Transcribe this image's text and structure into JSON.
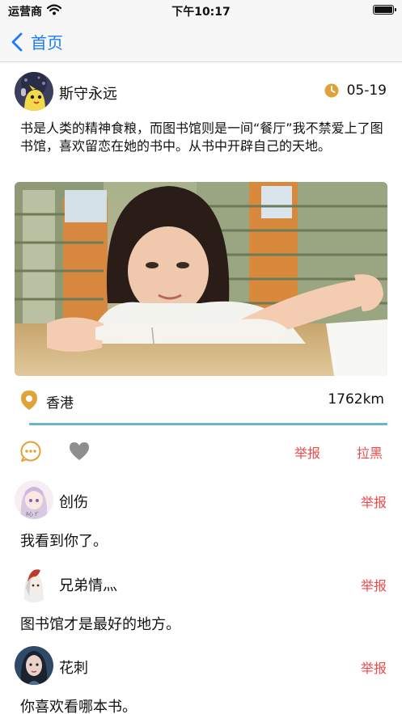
{
  "status_bar": {
    "carrier": "运营商",
    "time": "下午10:17"
  },
  "nav": {
    "back_label": "首页"
  },
  "post": {
    "username": "斯守永远",
    "date": "05-19",
    "text": "书是人类的精神食粮，而图书馆则是一间“餐厅”我不禁爱上了图书馆，喜欢留恋在她的书中。从书中开辟自己的天地。",
    "location": "香港",
    "distance": "1762km",
    "report_label": "举报",
    "block_label": "拉黑"
  },
  "comments": [
    {
      "name": "创伤",
      "text": "我看到你了。",
      "report_label": "举报"
    },
    {
      "name": "兄弟情灬",
      "text": "图书馆才是最好的地方。",
      "report_label": "举报"
    },
    {
      "name": "花刺",
      "text": "你喜欢看哪本书。",
      "report_label": "举报"
    }
  ],
  "colors": {
    "accent_blue": "#1a7bff",
    "icon_orange": "#e0a23a",
    "report_red": "#f04848",
    "divider_blue": "#6ab4cf"
  },
  "icons": {
    "back": "chevron-left-icon",
    "clock": "clock-icon",
    "location": "location-pin-icon",
    "comment": "comment-bubble-icon",
    "like": "heart-icon"
  }
}
